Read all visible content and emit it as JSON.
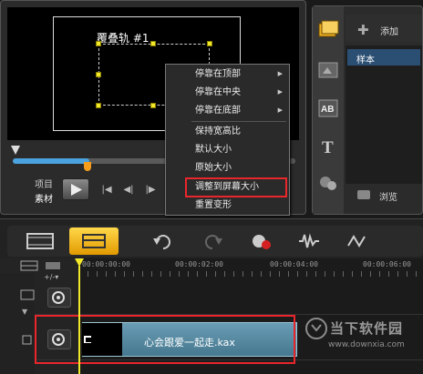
{
  "preview": {
    "overlay_track_label": "覆叠轨 #1",
    "mode_project": "项目",
    "mode_clip": "素材"
  },
  "context_menu": {
    "items": [
      {
        "label": "停靠在顶部",
        "submenu": true
      },
      {
        "label": "停靠在中央",
        "submenu": true
      },
      {
        "label": "停靠在底部",
        "submenu": true
      },
      {
        "label": "保持宽高比",
        "submenu": false
      },
      {
        "label": "默认大小",
        "submenu": false
      },
      {
        "label": "原始大小",
        "submenu": false
      },
      {
        "label": "调整到屏幕大小",
        "submenu": false
      },
      {
        "label": "重置变形",
        "submenu": false
      }
    ],
    "highlighted_index": 6
  },
  "library": {
    "add_label": "添加",
    "selected_item": "样本",
    "browse_label": "浏览"
  },
  "timeline": {
    "ruler": [
      "00:00:00:00",
      "00:00:02:00",
      "00:00:04:00",
      "00:00:06:00"
    ],
    "clip_label": "心会跟爱一起走.kax"
  },
  "watermark": {
    "title": "当下软件园",
    "url": "www.downxia.com"
  },
  "colors": {
    "accent_yellow": "#f2e82a",
    "highlight_red": "#e8262c",
    "clip_blue": "#5a8ca3",
    "selection_blue": "#2b4f73"
  }
}
